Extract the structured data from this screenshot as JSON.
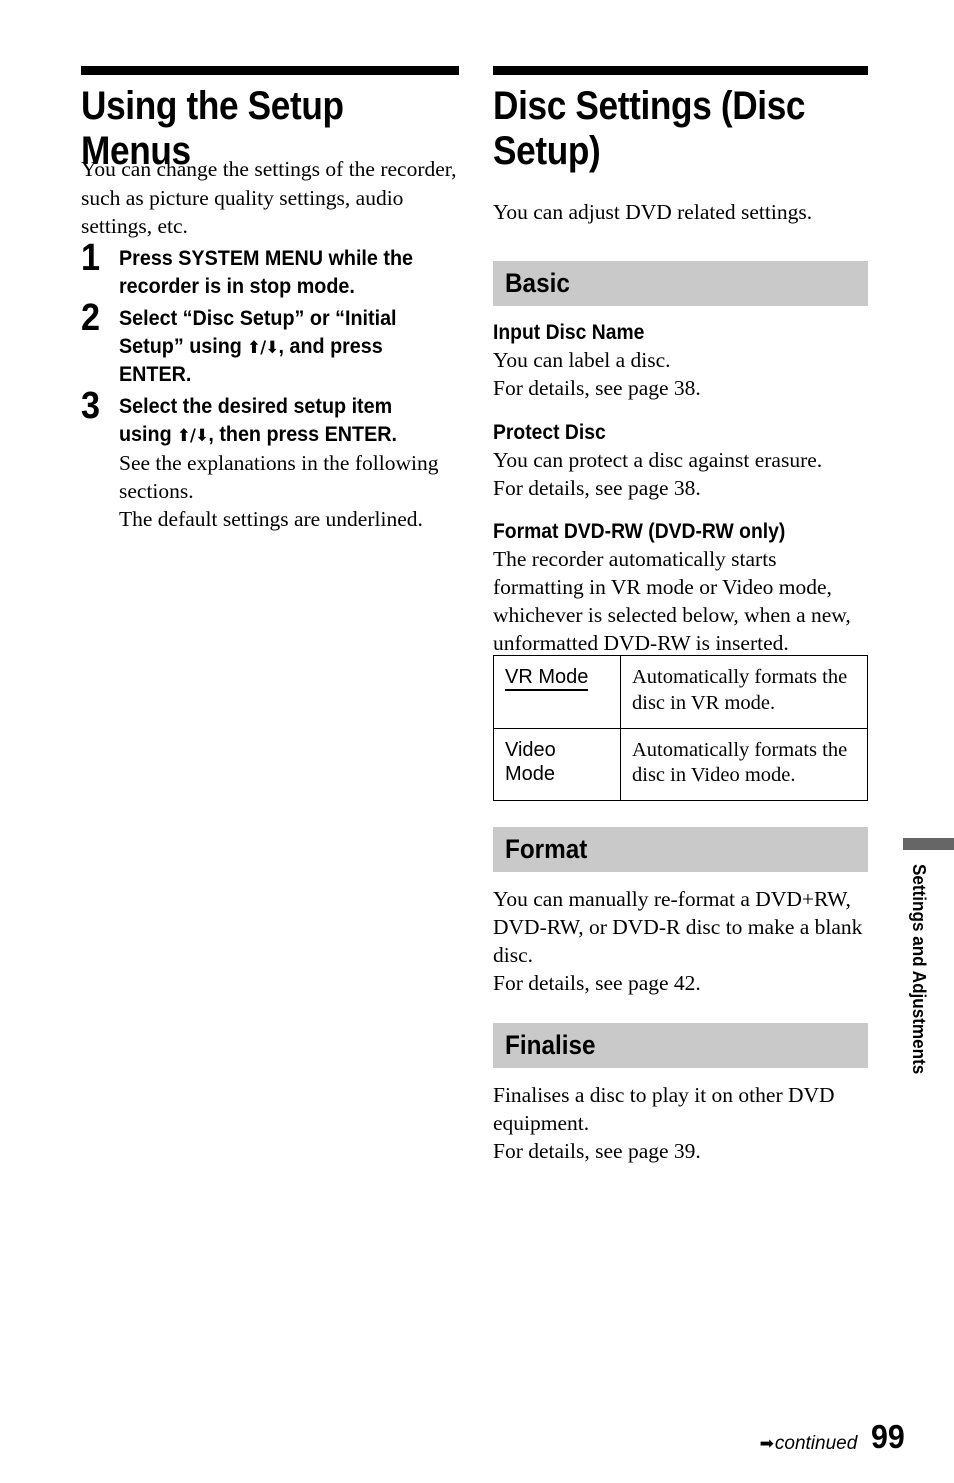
{
  "left_column": {
    "title": "Using the Setup Menus",
    "intro": "You can change the settings of the recorder, such as picture quality settings, audio settings, etc.",
    "steps": [
      {
        "number": "1",
        "instruction": "Press SYSTEM MENU while the recorder is in stop mode.",
        "note": ""
      },
      {
        "number": "2",
        "instruction_before": "Select “Disc Setup” or “Initial Setup” using ",
        "arrows": "⬆/⬇",
        "instruction_after": ", and press ENTER.",
        "note": ""
      },
      {
        "number": "3",
        "instruction_before": "Select the desired setup item using ",
        "arrows": "⬆/⬇",
        "instruction_after": ", then press ENTER.",
        "note": "See the explanations in the following sections.\nThe default settings are underlined."
      }
    ]
  },
  "right_column": {
    "title": "Disc Settings (Disc Setup)",
    "intro": "You can adjust DVD related settings.",
    "sections": [
      {
        "bar_label": "Basic",
        "items": [
          {
            "heading": "Input Disc Name",
            "body": "You can label a disc.\nFor details, see page 38."
          },
          {
            "heading": "Protect Disc",
            "body": "You can protect a disc against erasure.\nFor details, see page 38."
          },
          {
            "heading": "Format DVD-RW (DVD-RW only)",
            "body": "The recorder automatically starts formatting in VR mode or Video mode, whichever is selected below, when a new, unformatted DVD-RW is inserted."
          }
        ],
        "table": {
          "rows": [
            {
              "name": "VR Mode",
              "name_underlined": true,
              "description": "Automatically formats the disc in VR mode."
            },
            {
              "name": "Video\nMode",
              "name_underlined": false,
              "description": "Automatically formats the disc in Video mode."
            }
          ]
        }
      },
      {
        "bar_label": "Format",
        "items": [
          {
            "heading": "",
            "body": "You can manually re-format a DVD+RW, DVD-RW, or DVD-R disc to make a blank disc.\nFor details, see page 42."
          }
        ]
      },
      {
        "bar_label": "Finalise",
        "items": [
          {
            "heading": "",
            "body": "Finalises a disc to play it on other DVD equipment.\nFor details, see page 39."
          }
        ]
      }
    ]
  },
  "side_tab": {
    "label": "Settings and Adjustments",
    "bar_color": "#666666"
  },
  "footer": {
    "arrow": "➡",
    "continued": "continued",
    "page_number": "99"
  },
  "colors": {
    "section_bar": "#c9c9c9",
    "rule": "#000000"
  }
}
